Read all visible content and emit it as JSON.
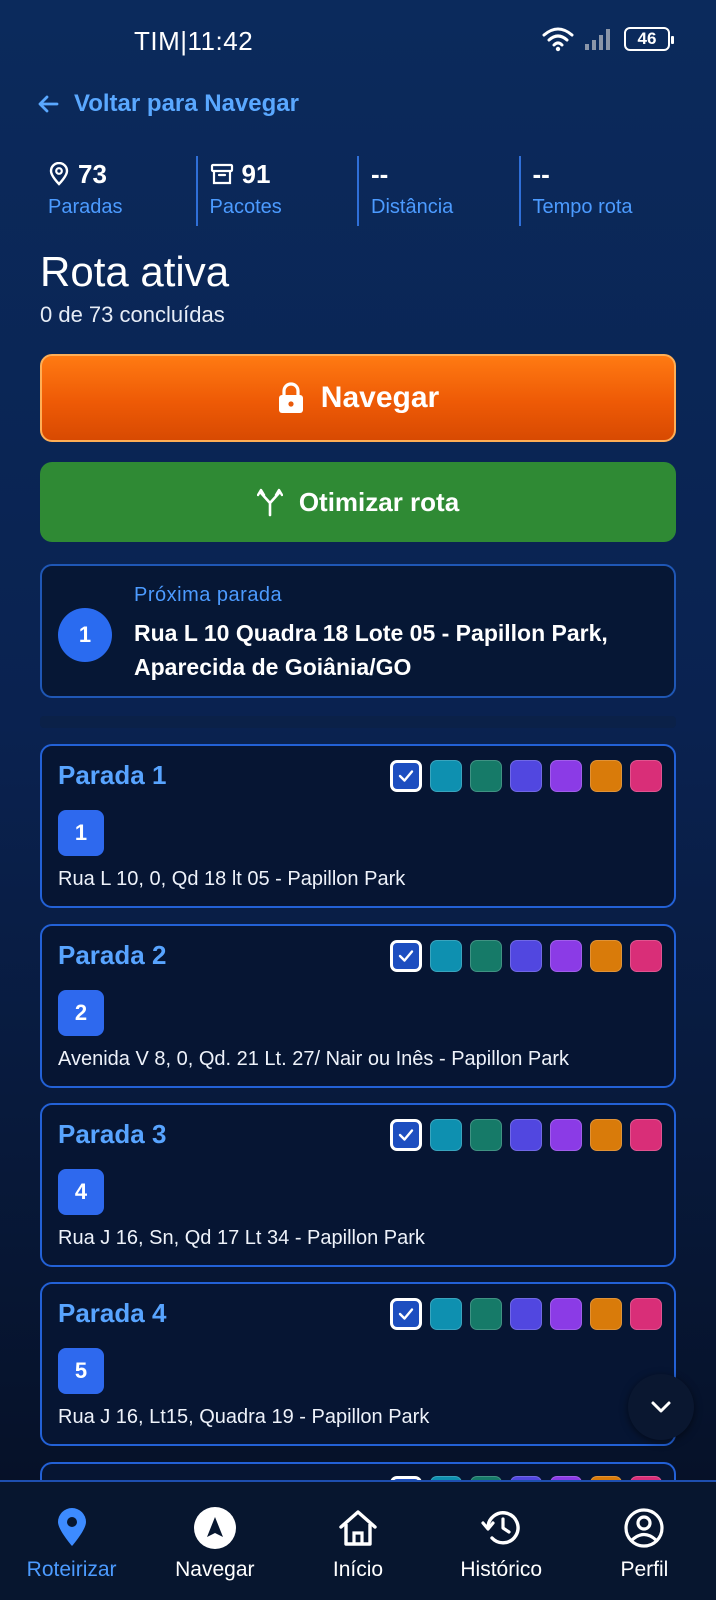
{
  "status_bar": {
    "carrier_time": "TIM|11:42",
    "battery": "46"
  },
  "back_link": {
    "label": "Voltar para Navegar"
  },
  "stats": [
    {
      "value": "73",
      "label": "Paradas",
      "icon": "map-pin-icon"
    },
    {
      "value": "91",
      "label": "Pacotes",
      "icon": "archive-box-icon"
    },
    {
      "value": "--",
      "label": "Distância"
    },
    {
      "value": "--",
      "label": "Tempo rota"
    }
  ],
  "route": {
    "title": "Rota ativa",
    "subtitle": "0 de 73 concluídas"
  },
  "buttons": {
    "navigate": "Navegar",
    "optimize": "Otimizar rota"
  },
  "next_stop": {
    "label": "Próxima parada",
    "number": "1",
    "address": "Rua L 10 Quadra 18 Lote 05 - Papillon Park, Aparecida de Goiânia/GO"
  },
  "colors": {
    "swatches": [
      "#1d4ec0",
      "#0e90b0",
      "#167a68",
      "#5147e0",
      "#8b3be6",
      "#d97b0a",
      "#d92e78"
    ],
    "accent": "#4c9bff",
    "navigate_orange": "#ee5a06",
    "optimize_green": "#2f8a34"
  },
  "stops": [
    {
      "title": "Parada 1",
      "number": "1",
      "address": "Rua L 10, 0, Qd 18 lt 05 - Papillon Park"
    },
    {
      "title": "Parada 2",
      "number": "2",
      "address": "Avenida V 8, 0, Qd. 21 Lt. 27/ Nair ou Inês - Papillon Park"
    },
    {
      "title": "Parada 3",
      "number": "4",
      "address": "Rua J 16, Sn, Qd 17 Lt 34 - Papillon Park"
    },
    {
      "title": "Parada 4",
      "number": "5",
      "address": "Rua J 16, Lt15, Quadra 19 - Papillon Park"
    }
  ],
  "tabs": [
    {
      "label": "Roteirizar",
      "icon": "map-pin-icon",
      "active": true
    },
    {
      "label": "Navegar",
      "icon": "navigation-arrow-icon",
      "active": false
    },
    {
      "label": "Início",
      "icon": "home-icon",
      "active": false
    },
    {
      "label": "Histórico",
      "icon": "history-icon",
      "active": false
    },
    {
      "label": "Perfil",
      "icon": "user-circle-icon",
      "active": false
    }
  ]
}
